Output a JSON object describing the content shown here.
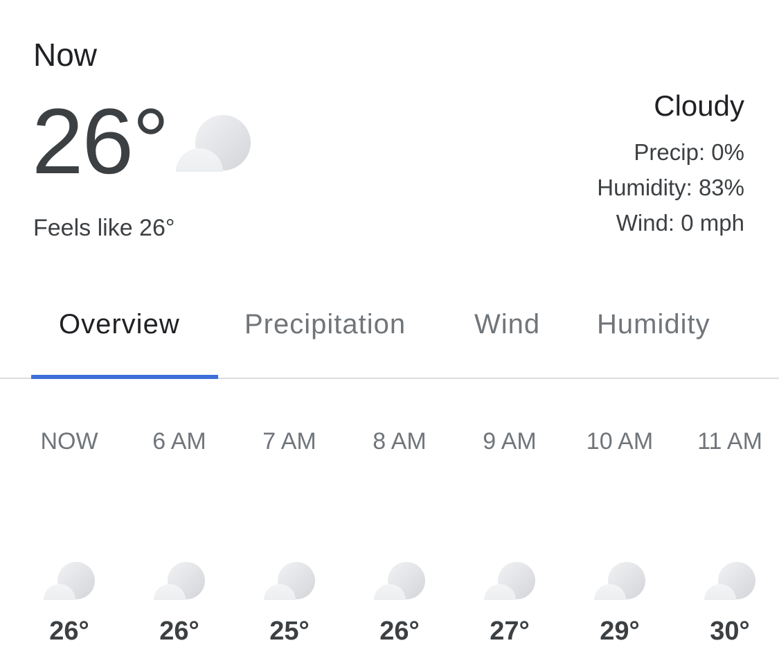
{
  "current": {
    "label": "Now",
    "temperature": "26°",
    "icon": "cloudy-icon",
    "feels_like": "Feels like 26°",
    "condition": "Cloudy",
    "precip": "Precip: 0%",
    "humidity": "Humidity: 83%",
    "wind": "Wind: 0 mph"
  },
  "tabs": [
    {
      "label": "Overview",
      "active": true
    },
    {
      "label": "Precipitation",
      "active": false
    },
    {
      "label": "Wind",
      "active": false
    },
    {
      "label": "Humidity",
      "active": false
    }
  ],
  "hourly": [
    {
      "time": "NOW",
      "temp": "26°",
      "icon": "cloudy-icon"
    },
    {
      "time": "6 AM",
      "temp": "26°",
      "icon": "cloudy-icon"
    },
    {
      "time": "7 AM",
      "temp": "25°",
      "icon": "cloudy-icon"
    },
    {
      "time": "8 AM",
      "temp": "26°",
      "icon": "cloudy-icon"
    },
    {
      "time": "9 AM",
      "temp": "27°",
      "icon": "cloudy-icon"
    },
    {
      "time": "10 AM",
      "temp": "29°",
      "icon": "cloudy-icon"
    },
    {
      "time": "11 AM",
      "temp": "30°",
      "icon": "cloudy-icon"
    }
  ],
  "colors": {
    "accent": "#3d6fd8",
    "text_primary": "#202124",
    "text_secondary": "#70757a"
  }
}
